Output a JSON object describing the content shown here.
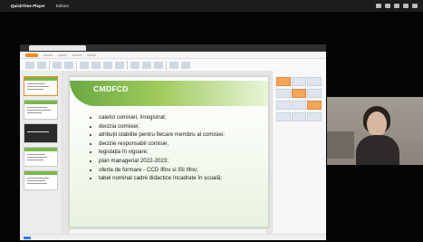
{
  "menubar": {
    "app_name": "QuickTime Player",
    "menus": [
      "",
      "Editare",
      "",
      "",
      ""
    ]
  },
  "editor": {
    "slide": {
      "title": "CMDFCD",
      "bullets": [
        "caietul comisiei, înregistrat;",
        "decizia comisiei;",
        "atribuții stabilite pentru fiecare membru al comisiei;",
        "decizie responsabil comisie;",
        "legislația în vigoare;",
        "plan managerial 2022-2023;",
        "oferta de formare - CCD Ilfov si ISI Ilfov;",
        "tabel nominal cadre didactice încadrate în școală;"
      ]
    }
  },
  "colors": {
    "slide_green": "#6aa842",
    "accent_orange": "#f08a24"
  }
}
